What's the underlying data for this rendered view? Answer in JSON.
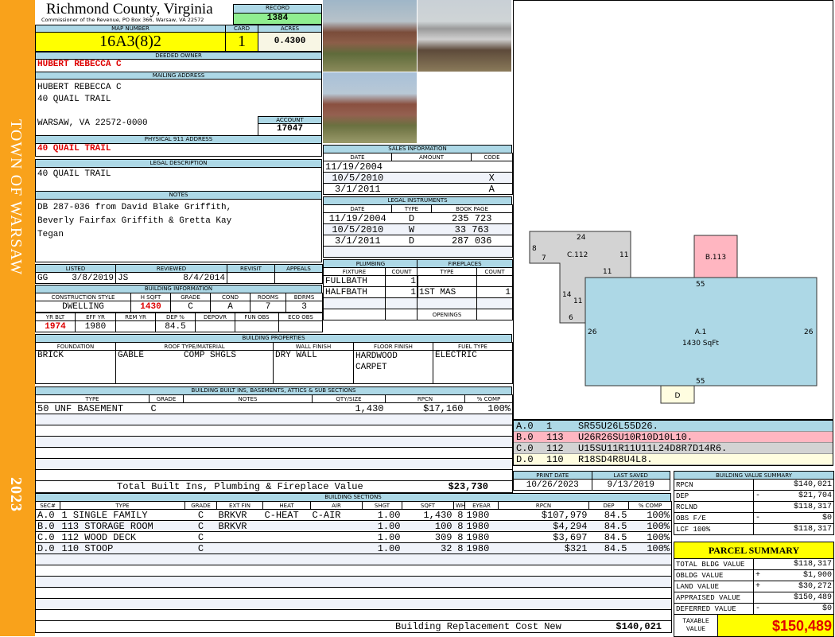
{
  "sidebar": {
    "town": "TOWN OF WARSAW",
    "year": "2023"
  },
  "header": {
    "county": "Richmond County, Virginia",
    "office": "Commissioner of the Revenue, PO Box 366, Warsaw, VA 22572",
    "record_label": "RECORD",
    "record": "1384"
  },
  "parcel": {
    "map_label": "MAP NUMBER",
    "map": "16A3(8)2",
    "card_label": "CARD",
    "card": "1",
    "acres_label": "ACRES",
    "acres": "0.4300"
  },
  "owner": {
    "label": "DEEDED OWNER",
    "name": "HUBERT REBECCA C"
  },
  "mailing": {
    "label": "MAILING ADDRESS",
    "line1": "HUBERT REBECCA C",
    "line2": "40 QUAIL TRAIL",
    "line3": "WARSAW, VA 22572-0000",
    "account_label": "ACCOUNT",
    "account": "17047"
  },
  "physical": {
    "label": "PHYSICAL 911 ADDRESS",
    "address": "40 QUAIL TRAIL"
  },
  "legal": {
    "label": "LEGAL DESCRIPTION",
    "text": "40 QUAIL TRAIL"
  },
  "notes": {
    "label": "NOTES",
    "line1": "DB 287-036 from David Blake Griffith,",
    "line2": "Beverly Fairfax Griffith & Gretta Kay",
    "line3": "Tegan"
  },
  "listing": {
    "listed_label": "LISTED",
    "reviewed_label": "REVIEWED",
    "revisit_label": "REVISIT",
    "appeals_label": "APPEALS",
    "listed_by": "GG",
    "listed_date": "3/8/2019",
    "reviewed_by": "JS",
    "reviewed_date": "8/4/2014"
  },
  "building_info": {
    "label": "BUILDING INFORMATION",
    "h": [
      "CONSTRUCTION STYLE",
      "H SQFT",
      "GRADE",
      "COND",
      "ROOMS",
      "BDRMS"
    ],
    "v": [
      "DWELLING",
      "1430",
      "C",
      "A",
      "7",
      "3"
    ],
    "h2": [
      "YR BLT",
      "EFF YR",
      "REM YR",
      "DEP %",
      "DEPOVR",
      "FUN OBS",
      "ECO OBS"
    ],
    "v2": [
      "1974",
      "1980",
      "",
      "84.5",
      "",
      "",
      ""
    ]
  },
  "sales": {
    "label": "SALES INFORMATION",
    "cols": [
      "DATE",
      "AMOUNT",
      "CODE"
    ],
    "rows": [
      [
        "11/19/2004",
        "",
        ""
      ],
      [
        "10/5/2010",
        "",
        "X"
      ],
      [
        "3/1/2011",
        "",
        "A"
      ]
    ]
  },
  "instruments": {
    "label": "LEGAL INSTRUMENTS",
    "cols": [
      "DATE",
      "TYPE",
      "BOOK PAGE"
    ],
    "rows": [
      [
        "11/19/2004",
        "D",
        "235 723"
      ],
      [
        "10/5/2010",
        "W",
        "33 763"
      ],
      [
        "3/1/2011",
        "D",
        "287 036"
      ]
    ]
  },
  "plumbing": {
    "label": "PLUMBING",
    "cols": [
      "FIXTURE",
      "COUNT"
    ],
    "rows": [
      [
        "FULLBATH",
        "1"
      ],
      [
        "HALFBATH",
        "1"
      ]
    ]
  },
  "fireplaces": {
    "label": "FIREPLACES",
    "cols": [
      "TYPE",
      "COUNT"
    ],
    "rows": [
      [
        "",
        ""
      ],
      [
        "1ST MAS",
        "1"
      ]
    ],
    "openings_label": "OPENINGS"
  },
  "properties": {
    "label": "BUILDING PROPERTIES",
    "cols": [
      "FOUNDATION",
      "ROOF TYPE/MATERIAL",
      "WALL FINISH",
      "FLOOR FINISH",
      "FUEL TYPE"
    ],
    "foundation": "BRICK",
    "roof_type": "GABLE",
    "roof_material": "COMP SHGLS",
    "wall": "DRY WALL",
    "floor1": "HARDWOOD",
    "floor2": "CARPET",
    "fuel": "ELECTRIC"
  },
  "builtins": {
    "label": "BUILDING BUILT INS, BASEMENTS, ATTICS & SUB SECTIONS",
    "cols": [
      "TYPE",
      "GRADE",
      "NOTES",
      "QTY/SIZE",
      "RPCN",
      "% COMP"
    ],
    "rows": [
      [
        "50 UNF BASEMENT",
        "C",
        "",
        "1,430",
        "$17,160",
        "100%"
      ]
    ],
    "total_label": "Total Built Ins, Plumbing & Fireplace Value",
    "total": "$23,730"
  },
  "sections": {
    "label": "BUILDING SECTIONS",
    "cols": [
      "SEC#",
      "TYPE",
      "GRADE",
      "EXT FIN",
      "HEAT",
      "AIR",
      "SHGT",
      "SQFT",
      "WHGT",
      "EYEAR",
      "RPCN",
      "DEP",
      "% COMP"
    ],
    "rows": [
      [
        "A.0",
        "1 SINGLE FAMILY",
        "C",
        "BRKVR",
        "C-HEAT",
        "C-AIR",
        "1.00",
        "1,430",
        "8",
        "1980",
        "$107,979",
        "84.5",
        "100%"
      ],
      [
        "B.0",
        "113 STORAGE ROOM",
        "C",
        "BRKVR",
        "",
        "",
        "1.00",
        "100",
        "8",
        "1980",
        "$4,294",
        "84.5",
        "100%"
      ],
      [
        "C.0",
        "112 WOOD DECK",
        "C",
        "",
        "",
        "",
        "1.00",
        "309",
        "8",
        "1980",
        "$3,697",
        "84.5",
        "100%"
      ],
      [
        "D.0",
        "110 STOOP",
        "C",
        "",
        "",
        "",
        "1.00",
        "32",
        "8",
        "1980",
        "$321",
        "84.5",
        "100%"
      ]
    ],
    "total_label": "Building Replacement Cost New",
    "total": "$140,021"
  },
  "sketch": {
    "labels": {
      "c_top": "24",
      "c_left1": "8",
      "c_left2": "7",
      "c_name": "C.112",
      "c_right": "11",
      "c_bottom": "11",
      "c_l14": "14",
      "c_l11": "11",
      "c_l6": "6",
      "a_top": "55",
      "a_left": "26",
      "a_right": "26",
      "a_name": "A.1",
      "a_area": "1430 SqFt",
      "a_bottom": "55",
      "b_name": "B.113",
      "d_name": "D"
    },
    "colors": {
      "A": "#add8e6",
      "B": "#ffb6c1",
      "C": "#d3d3d3",
      "D": "#fffde0"
    },
    "rows": [
      [
        "A.0",
        "1",
        "SR55U26L55D26."
      ],
      [
        "B.0",
        "113",
        "U26R26SU10R10D10L10."
      ],
      [
        "C.0",
        "112",
        "U15SU11R11U11L24D8R7D14R6."
      ],
      [
        "D.0",
        "110",
        "R18SD4R8U4L8."
      ]
    ]
  },
  "dates": {
    "print_label": "PRINT DATE",
    "print": "10/26/2023",
    "saved_label": "LAST SAVED",
    "saved": "9/13/2019"
  },
  "value_summary": {
    "label": "BUILDING VALUE SUMMARY",
    "rows": [
      [
        "RPCN",
        "",
        "$140,021"
      ],
      [
        "DEP",
        "-",
        "$21,704"
      ],
      [
        "RCLND",
        "",
        "$118,317"
      ],
      [
        "OBS F/E",
        "-",
        "$0"
      ],
      [
        "LCF  100%",
        "",
        "$118,317"
      ]
    ]
  },
  "parcel_summary": {
    "label": "PARCEL SUMMARY",
    "rows": [
      [
        "TOTAL BLDG VALUE",
        "",
        "$118,317"
      ],
      [
        "OBLDG VALUE",
        "+",
        "$1,900"
      ],
      [
        "LAND VALUE",
        "+",
        "$30,272"
      ],
      [
        "APPRAISED VALUE",
        "",
        "$150,489"
      ],
      [
        "DEFERRED VALUE",
        "-",
        "$0"
      ]
    ],
    "taxable_label1": "TAXABLE",
    "taxable_label2": "VALUE",
    "taxable": "$150,489"
  }
}
